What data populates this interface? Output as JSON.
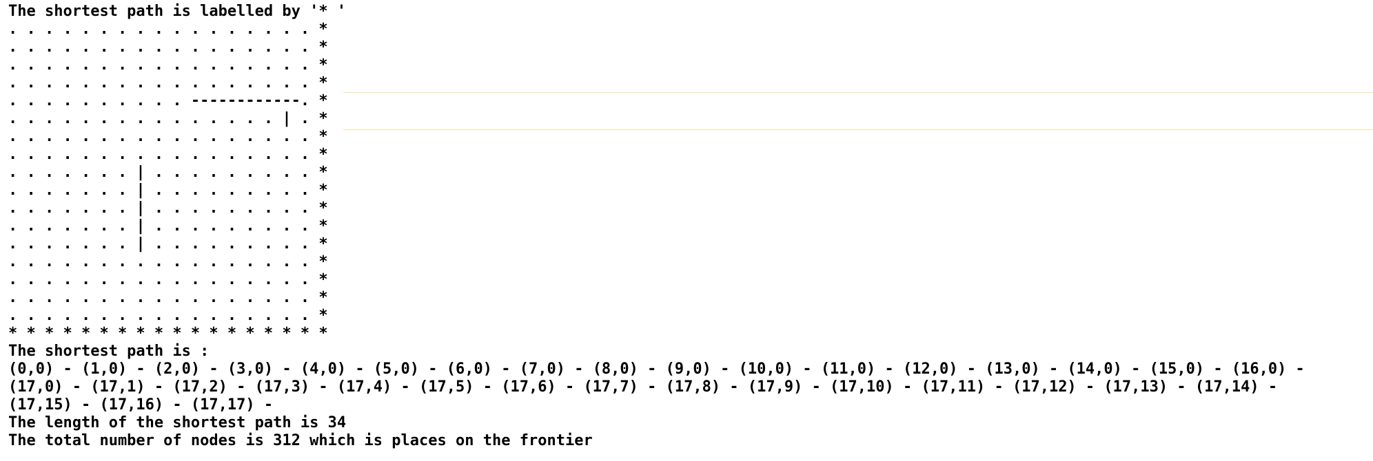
{
  "console": {
    "header": "The shortest path is labelled by '* '",
    "grid_rows": [
      ". . . . . . . . . . . . . . . . . *",
      ". . . . . . . . . . . . . . . . . *",
      ". . . . . . . . . . . . . . . . . *",
      ". . . . . . . . . . . . . . . . . *",
      ". . . . . . . . . . ------------. *",
      ". . . . . . . . . . . . . . . | . *",
      ". . . . . . . . . . . . . . . . . *",
      ". . . . . . . . . . . . . . . . . *",
      ". . . . . . . | . . . . . . . . . *",
      ". . . . . . . | . . . . . . . . . *",
      ". . . . . . . | . . . . . . . . . *",
      ". . . . . . . | . . . . . . . . . *",
      ". . . . . . . | . . . . . . . . . *",
      ". . . . . . . . . . . . . . . . . *",
      ". . . . . . . . . . . . . . . . . *",
      ". . . . . . . . . . . . . . . . . *",
      ". . . . . . . . . . . . . . . . . *",
      "* * * * * * * * * * * * * * * * * *"
    ],
    "path_label": "The shortest path is :",
    "path_lines": [
      "(0,0) - (1,0) - (2,0) - (3,0) - (4,0) - (5,0) - (6,0) - (7,0) - (8,0) - (9,0) - (10,0) - (11,0) - (12,0) - (13,0) - (14,0) - (15,0) - (16,0) -",
      "(17,0) - (17,1) - (17,2) - (17,3) - (17,4) - (17,5) - (17,6) - (17,7) - (17,8) - (17,9) - (17,10) - (17,11) - (17,12) - (17,13) - (17,14) -",
      "(17,15) - (17,16) - (17,17) -"
    ],
    "length_line": "The length of the shortest path is 34",
    "nodes_line": "The total number of nodes is 312 which is places on the frontier"
  },
  "colors": {
    "text": "#000000",
    "background": "#ffffff",
    "guide_line": "#f2e3a0"
  }
}
